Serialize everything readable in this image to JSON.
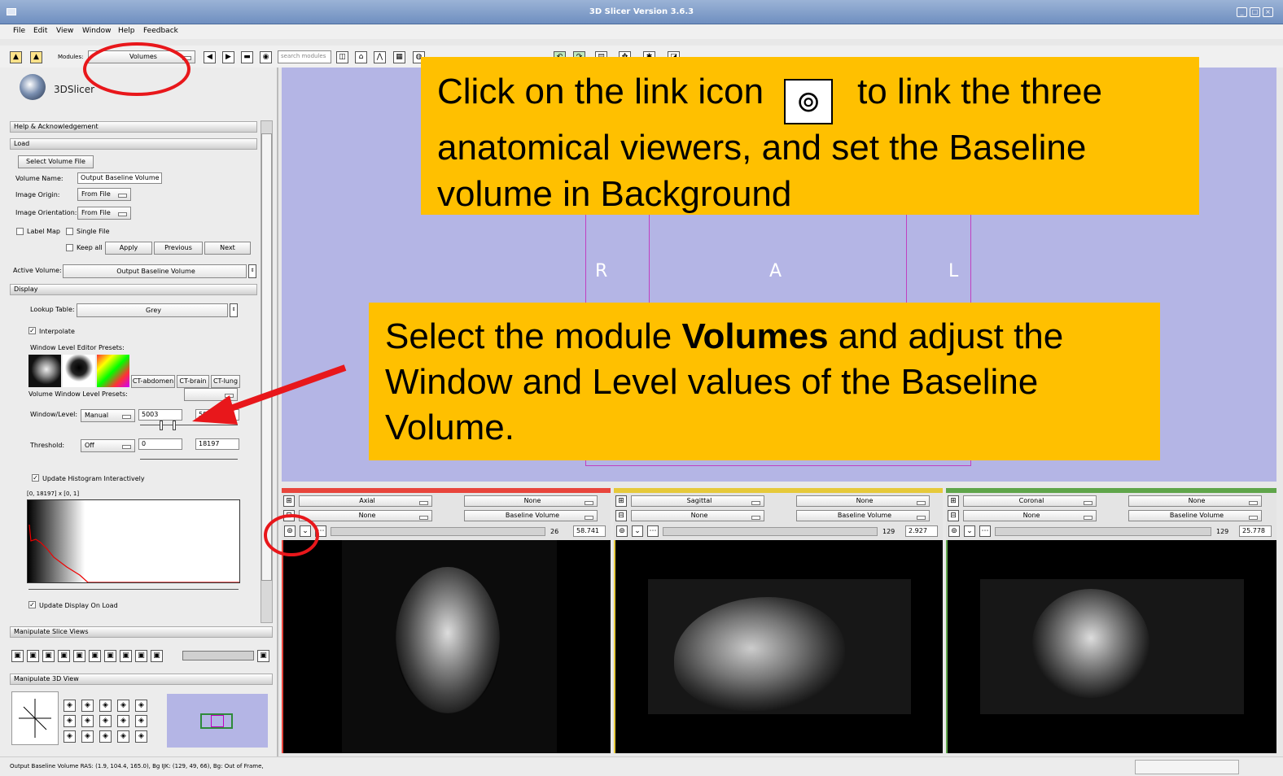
{
  "window": {
    "title": "3D Slicer Version 3.6.3"
  },
  "menu": [
    "File",
    "Edit",
    "View",
    "Window",
    "Help",
    "Feedback"
  ],
  "toolbar": {
    "modules_label": "Modules:",
    "module_selected": "Volumes",
    "search_placeholder": "search modules"
  },
  "logo_text": "3DSlicer",
  "panel": {
    "help_section": "Help & Acknowledgement",
    "load_section": "Load",
    "select_volume_file": "Select Volume File",
    "volume_name_label": "Volume Name:",
    "volume_name_value": "Output Baseline Volume",
    "image_origin_label": "Image Origin:",
    "image_origin_value": "From File",
    "image_orientation_label": "Image Orientation:",
    "image_orientation_value": "From File",
    "label_map": "Label Map",
    "single_file": "Single File",
    "keep_all": "Keep all",
    "apply": "Apply",
    "previous": "Previous",
    "next": "Next",
    "active_volume_label": "Active Volume:",
    "active_volume_value": "Output Baseline Volume",
    "display_section": "Display",
    "lookup_table_label": "Lookup Table:",
    "lookup_table_value": "Grey",
    "interpolate": "Interpolate",
    "wl_editor_presets": "Window Level Editor Presets:",
    "preset_ct_abdomen": "CT-abdomen",
    "preset_ct_brain": "CT-brain",
    "preset_ct_lung": "CT-lung",
    "volume_wl_presets": "Volume Window Level Presets:",
    "window_level_label": "Window/Level:",
    "window_level_mode": "Manual",
    "window_value": "5003",
    "level_value": "59.8",
    "threshold_label": "Threshold:",
    "threshold_mode": "Off",
    "threshold_min": "0",
    "threshold_max": "18197",
    "update_histogram": "Update Histogram Interactively",
    "histogram_range": "[0, 18197] x [0, 1]",
    "update_display_on_load": "Update Display On Load",
    "manipulate_slice_views": "Manipulate Slice Views",
    "manipulate_3d_view": "Manipulate 3D View"
  },
  "view3d": {
    "label_r": "R",
    "label_a": "A",
    "label_l": "L"
  },
  "slice_views": [
    {
      "name": "Axial",
      "row2_left": "None",
      "fg": "None",
      "bg": "Baseline Volume",
      "slice_index": "26",
      "offset": "58.741",
      "color": "#e8453c"
    },
    {
      "name": "Sagittal",
      "row2_left": "None",
      "fg": "None",
      "bg": "Baseline Volume",
      "slice_index": "129",
      "offset": "2.927",
      "color": "#e6c93a"
    },
    {
      "name": "Coronal",
      "row2_left": "None",
      "fg": "None",
      "bg": "Baseline Volume",
      "slice_index": "129",
      "offset": "25.778",
      "color": "#5fa54a"
    }
  ],
  "callouts": {
    "link_text_before": "Click on the link icon",
    "link_text_after": "to link the three",
    "link_line2": "anatomical viewers, and set the Baseline",
    "link_line3": "volume in Background",
    "module_before": "Select the module ",
    "module_bold": "Volumes",
    "module_after": " and adjust the",
    "module_line2": "Window and Level values of the Baseline",
    "module_line3": "Volume."
  },
  "status": "Output Baseline Volume RAS: (1.9, 104.4, 165.0), Bg IJK: (129, 49, 66), Bg: Out of Frame,",
  "colors": {
    "callout": "#ffc000",
    "view3d": "#b4b5e5",
    "annotation": "#e8171b"
  }
}
